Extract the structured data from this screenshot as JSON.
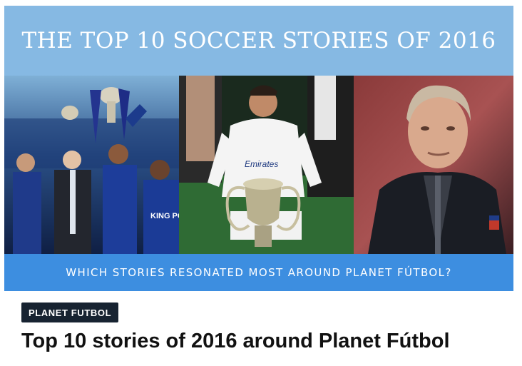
{
  "hero": {
    "title": "THE TOP 10 SOCCER STORIES OF 2016",
    "subtitle": "WHICH STORIES RESONATED MOST AROUND PLANET FÚTBOL?",
    "colors": {
      "top_banner": "#86b9e3",
      "bottom_banner": "#3d8ee0"
    }
  },
  "article": {
    "category": "PLANET FUTBOL",
    "headline": "Top 10 stories of 2016 around Planet Fútbol"
  },
  "photos": {
    "left_jersey_text": "KING POWER",
    "middle_jersey_text": "Emirates"
  }
}
